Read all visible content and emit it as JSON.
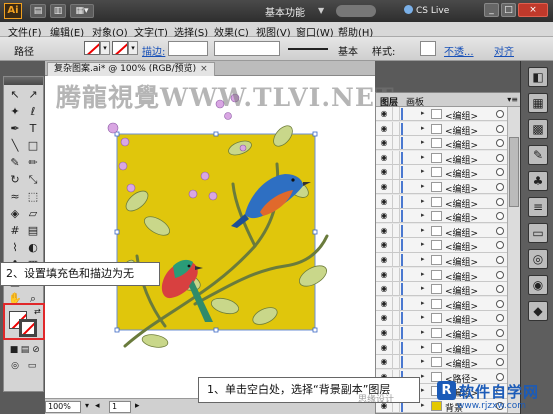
{
  "titlebar": {
    "app_logo": "Ai",
    "workspace": "基本功能",
    "cs_live": "CS Live",
    "window_buttons": [
      "_",
      "□",
      "×"
    ]
  },
  "menubar": {
    "items": [
      "文件(F)",
      "编辑(E)",
      "对象(O)",
      "文字(T)",
      "选择(S)",
      "效果(C)",
      "视图(V)",
      "窗口(W)",
      "帮助(H)"
    ]
  },
  "controlbar": {
    "path_label": "路径",
    "stroke_label": "描边:",
    "stroke_style": "基本",
    "style_label": "样式:",
    "opacity_label": "不透...",
    "align_label": "对齐"
  },
  "document": {
    "tab_title": "复杂图案.ai* @ 100% (RGB/预览)",
    "close": "×",
    "watermark": "腾龍視覺WWW.TLVI.NET"
  },
  "statusbar": {
    "zoom": "100%",
    "artboard_num": "1"
  },
  "layers_panel": {
    "tabs": [
      "图层",
      "画板"
    ],
    "menu_icon": "▾≡",
    "rows": [
      {
        "name": "<编组>",
        "thumb": "plain"
      },
      {
        "name": "<编组>",
        "thumb": "plain"
      },
      {
        "name": "<编组>",
        "thumb": "plain"
      },
      {
        "name": "<编组>",
        "thumb": "plain"
      },
      {
        "name": "<编组>",
        "thumb": "plain"
      },
      {
        "name": "<编组>",
        "thumb": "plain"
      },
      {
        "name": "<编组>",
        "thumb": "plain"
      },
      {
        "name": "<编组>",
        "thumb": "plain"
      },
      {
        "name": "<编组>",
        "thumb": "plain"
      },
      {
        "name": "<编组>",
        "thumb": "plain"
      },
      {
        "name": "<编组>",
        "thumb": "plain"
      },
      {
        "name": "<编组>",
        "thumb": "plain"
      },
      {
        "name": "<编组>",
        "thumb": "plain"
      },
      {
        "name": "<编组>",
        "thumb": "plain"
      },
      {
        "name": "<编组>",
        "thumb": "plain"
      },
      {
        "name": "<编组>",
        "thumb": "plain"
      },
      {
        "name": "<编组>",
        "thumb": "plain"
      },
      {
        "name": "<编组>",
        "thumb": "plain"
      },
      {
        "name": "<路径>",
        "thumb": "plain"
      },
      {
        "name": "<编组>",
        "thumb": "plain"
      },
      {
        "name": "背景",
        "thumb": "yellow"
      }
    ]
  },
  "callouts": {
    "step2": "2、设置填充色和描边为无",
    "step1": "1、单击空白处，选择“背景副本”图层",
    "faint_watermark": "思缘设计"
  },
  "branding": {
    "badge": "R",
    "name": "软件自学网",
    "url": "www.rjzxw.com"
  },
  "colors": {
    "artboard_yellow": "#e0c60c",
    "highlight_red": "#e0282a",
    "layer_blue": "#4a78d0"
  }
}
